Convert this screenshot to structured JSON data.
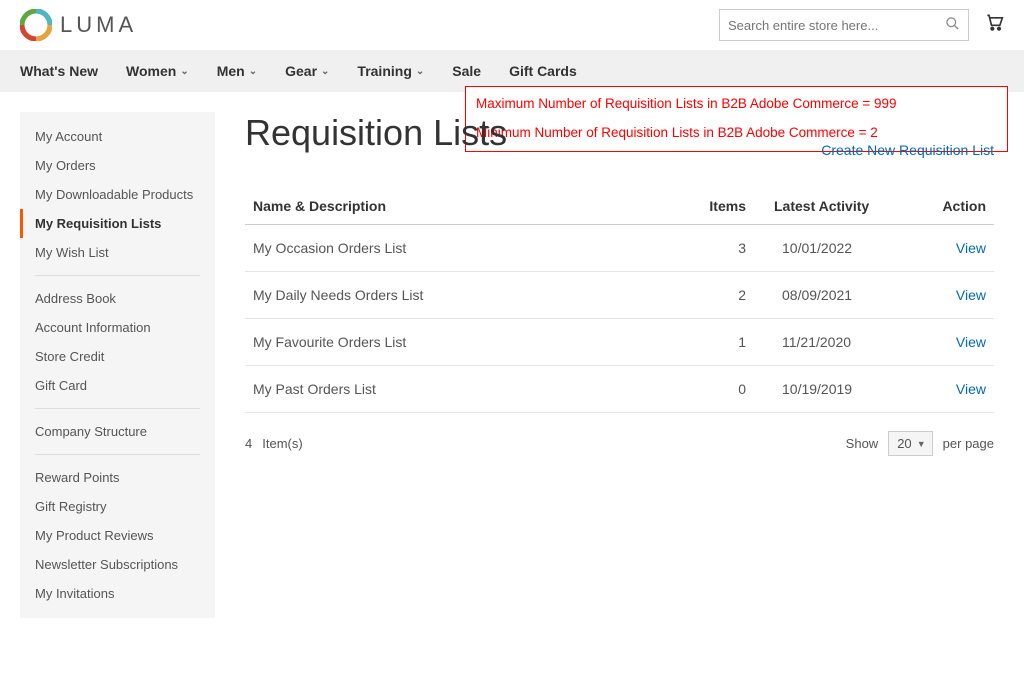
{
  "header": {
    "logo_text": "LUMA",
    "search_placeholder": "Search entire store here..."
  },
  "nav": {
    "items": [
      {
        "label": "What's New",
        "dropdown": false
      },
      {
        "label": "Women",
        "dropdown": true
      },
      {
        "label": "Men",
        "dropdown": true
      },
      {
        "label": "Gear",
        "dropdown": true
      },
      {
        "label": "Training",
        "dropdown": true
      },
      {
        "label": "Sale",
        "dropdown": false
      },
      {
        "label": "Gift Cards",
        "dropdown": false
      }
    ]
  },
  "annotation": {
    "line1": "Maximum Number of Requisition Lists in B2B Adobe Commerce = 999",
    "line2": "Minimum Number of Requisition Lists in B2B Adobe Commerce = 2"
  },
  "sidebar": {
    "groups": [
      [
        "My Account",
        "My Orders",
        "My Downloadable Products",
        "My Requisition Lists",
        "My Wish List"
      ],
      [
        "Address Book",
        "Account Information",
        "Store Credit",
        "Gift Card"
      ],
      [
        "Company Structure"
      ],
      [
        "Reward Points",
        "Gift Registry",
        "My Product Reviews",
        "Newsletter Subscriptions",
        "My Invitations"
      ]
    ],
    "active": "My Requisition Lists"
  },
  "page": {
    "title": "Requisition Lists",
    "create_link": "Create New Requisition List"
  },
  "table": {
    "headers": {
      "name": "Name & Description",
      "items": "Items",
      "activity": "Latest Activity",
      "action": "Action"
    },
    "rows": [
      {
        "name": "My Occasion  Orders  List",
        "items": "3",
        "activity": "10/01/2022",
        "action": "View"
      },
      {
        "name": "My Daily Needs Orders  List",
        "items": "2",
        "activity": "08/09/2021",
        "action": "View"
      },
      {
        "name": "My Favourite Orders  List",
        "items": "1",
        "activity": "11/21/2020",
        "action": "View"
      },
      {
        "name": "My Past Orders  List",
        "items": "0",
        "activity": "10/19/2019",
        "action": "View"
      }
    ]
  },
  "footer": {
    "count_num": "4",
    "count_label": "Item(s)",
    "show_label": "Show",
    "per_page_value": "20",
    "per_page_label": "per page"
  }
}
